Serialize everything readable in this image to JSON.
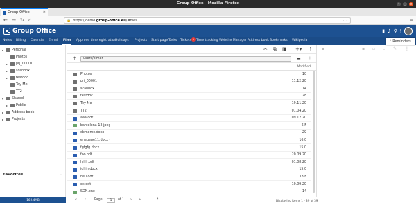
{
  "window": {
    "title": "Group-Office - Mozilla Firefox"
  },
  "browser": {
    "tab_label": "Group-Office",
    "tab_close": "×",
    "new_tab": "+",
    "url_prefix": "https://demo.",
    "url_domain": "group-office.eu",
    "url_suffix": "/#files",
    "page_actions": "···"
  },
  "app": {
    "name": "Group Office",
    "modules": [
      {
        "label": "Notes"
      },
      {
        "label": "Billing"
      },
      {
        "label": "Calendar"
      },
      {
        "label": "E-mail"
      },
      {
        "label": "Files",
        "active": true
      },
      {
        "label": "Approve timeregistration"
      },
      {
        "label": "Holidays"
      },
      {
        "label": "Projects"
      },
      {
        "label": "Start page"
      },
      {
        "label": "Tasks"
      },
      {
        "label": "Tickets",
        "badge": "1"
      },
      {
        "label": "Time tracking"
      },
      {
        "label": "Website Manager"
      },
      {
        "label": "Address book"
      },
      {
        "label": "Bookmarks"
      },
      {
        "label": "Wikipedia"
      }
    ],
    "reminders_label": "Reminders"
  },
  "tree": {
    "personal": "Personal",
    "personal_children": [
      "Photos",
      "prj_00001",
      "scanbox",
      "testdoc",
      "Tey Me",
      "TT2"
    ],
    "shared": "Shared",
    "shared_children": [
      "Public"
    ],
    "address_book": "Address book",
    "projects": "Projects",
    "favorites": "Favorites"
  },
  "path": {
    "value": "users/elmer"
  },
  "list": {
    "col_modified": "Modified",
    "rows": [
      {
        "name": "Photos",
        "icon": "folder",
        "mod": "10"
      },
      {
        "name": "prj_00001",
        "icon": "folder",
        "mod": "11.12.20"
      },
      {
        "name": "scanbox",
        "icon": "folder",
        "mod": "14"
      },
      {
        "name": "testdoc",
        "icon": "folder",
        "mod": "28"
      },
      {
        "name": "Tey Me",
        "icon": "folder",
        "mod": "19.11.20"
      },
      {
        "name": "TT2",
        "icon": "folder",
        "mod": "01.04.20"
      },
      {
        "name": "aaa.odt",
        "icon": "doc",
        "mod": "09.12.20"
      },
      {
        "name": "barcelona-12.jpeg",
        "icon": "img",
        "mod": "6 F"
      },
      {
        "name": "demome.docx",
        "icon": "doc",
        "mod": "29"
      },
      {
        "name": "enegepe11.docx -",
        "icon": "doc",
        "mod": "16.0"
      },
      {
        "name": "fgfgfg.docx",
        "icon": "doc",
        "mod": "15.0"
      },
      {
        "name": "foo.odt",
        "icon": "doc",
        "mod": "20.09.20"
      },
      {
        "name": "hjhh.odt",
        "icon": "doc",
        "mod": "01.08.20"
      },
      {
        "name": "jghjh.docx",
        "icon": "doc",
        "mod": "15.0"
      },
      {
        "name": "neu.odt",
        "icon": "doc",
        "mod": "18 F"
      },
      {
        "name": "ok.odt",
        "icon": "doc",
        "mod": "10.09.20"
      },
      {
        "name": "SON.one",
        "icon": "img",
        "mod": "14"
      }
    ]
  },
  "footer": {
    "quota": "(169.4MB)",
    "page_label": "Page",
    "page_value": "1",
    "of_label": "of 1",
    "display": "Displaying items 1 - 39 of 39"
  },
  "icons": {
    "back": "←",
    "forward": "→",
    "reload": "↻",
    "home": "⌂",
    "lock": "🔒",
    "menu": "≡",
    "cut": "✂",
    "copy": "⧉",
    "paste": "▣",
    "add": "+▾",
    "more": "⋮",
    "up": "↑",
    "search": "▬",
    "settings": "⚙",
    "chat": "▮",
    "bell": "♪",
    "grid": "⁝",
    "bell_small": "♪",
    "first": "«",
    "prev": "‹",
    "next": "›",
    "last": "»",
    "refresh": "↻"
  },
  "colors": {
    "brand": "#1d5191",
    "modnav": "#1b4c88",
    "active_tab_line": "#0a84ff"
  }
}
